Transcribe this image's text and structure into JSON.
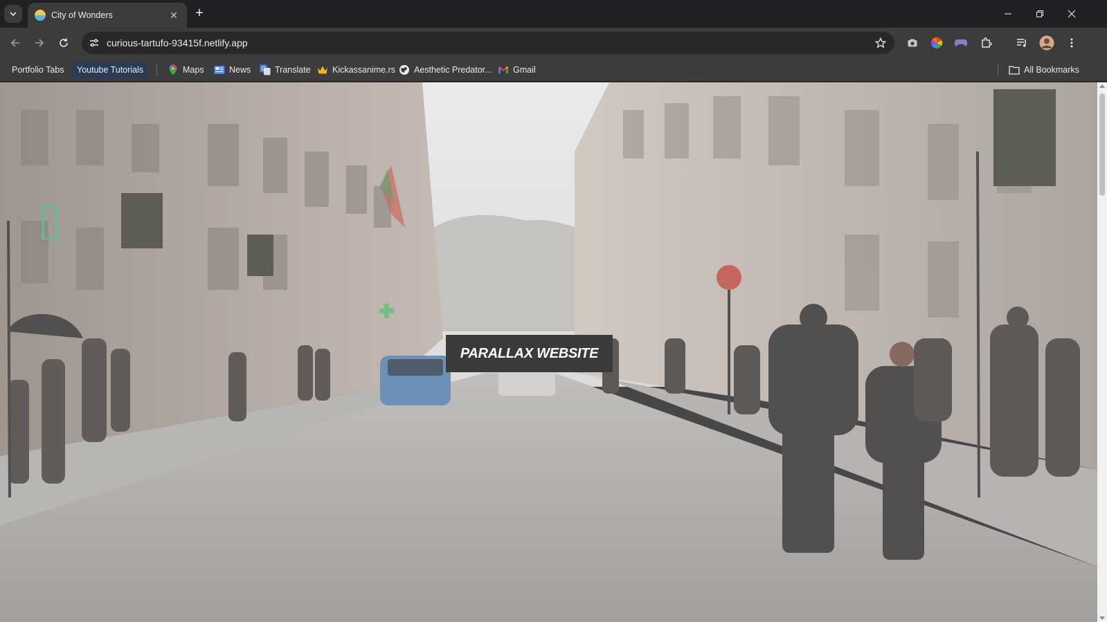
{
  "browser": {
    "tab": {
      "title": "City of Wonders"
    },
    "url": "curious-tartufo-93415f.netlify.app"
  },
  "bookmarks": [
    {
      "label": "Portfolio Tabs",
      "icon": "none"
    },
    {
      "label": "Youtube Tutorials",
      "icon": "none"
    },
    {
      "label": "Maps",
      "icon": "maps-icon"
    },
    {
      "label": "News",
      "icon": "news-icon"
    },
    {
      "label": "Translate",
      "icon": "translate-icon"
    },
    {
      "label": "Kickassanime.rs",
      "icon": "crown-icon"
    },
    {
      "label": "Aesthetic Predator...",
      "icon": "globe-icon"
    },
    {
      "label": "Gmail",
      "icon": "gmail-icon"
    }
  ],
  "all_bookmarks": "All Bookmarks",
  "page": {
    "hero_title": "PARALLAX WEBSITE"
  },
  "colors": {
    "sky": "#dcdcdc",
    "street": "#8f8d8a",
    "title_box": "#3a3a3a"
  }
}
